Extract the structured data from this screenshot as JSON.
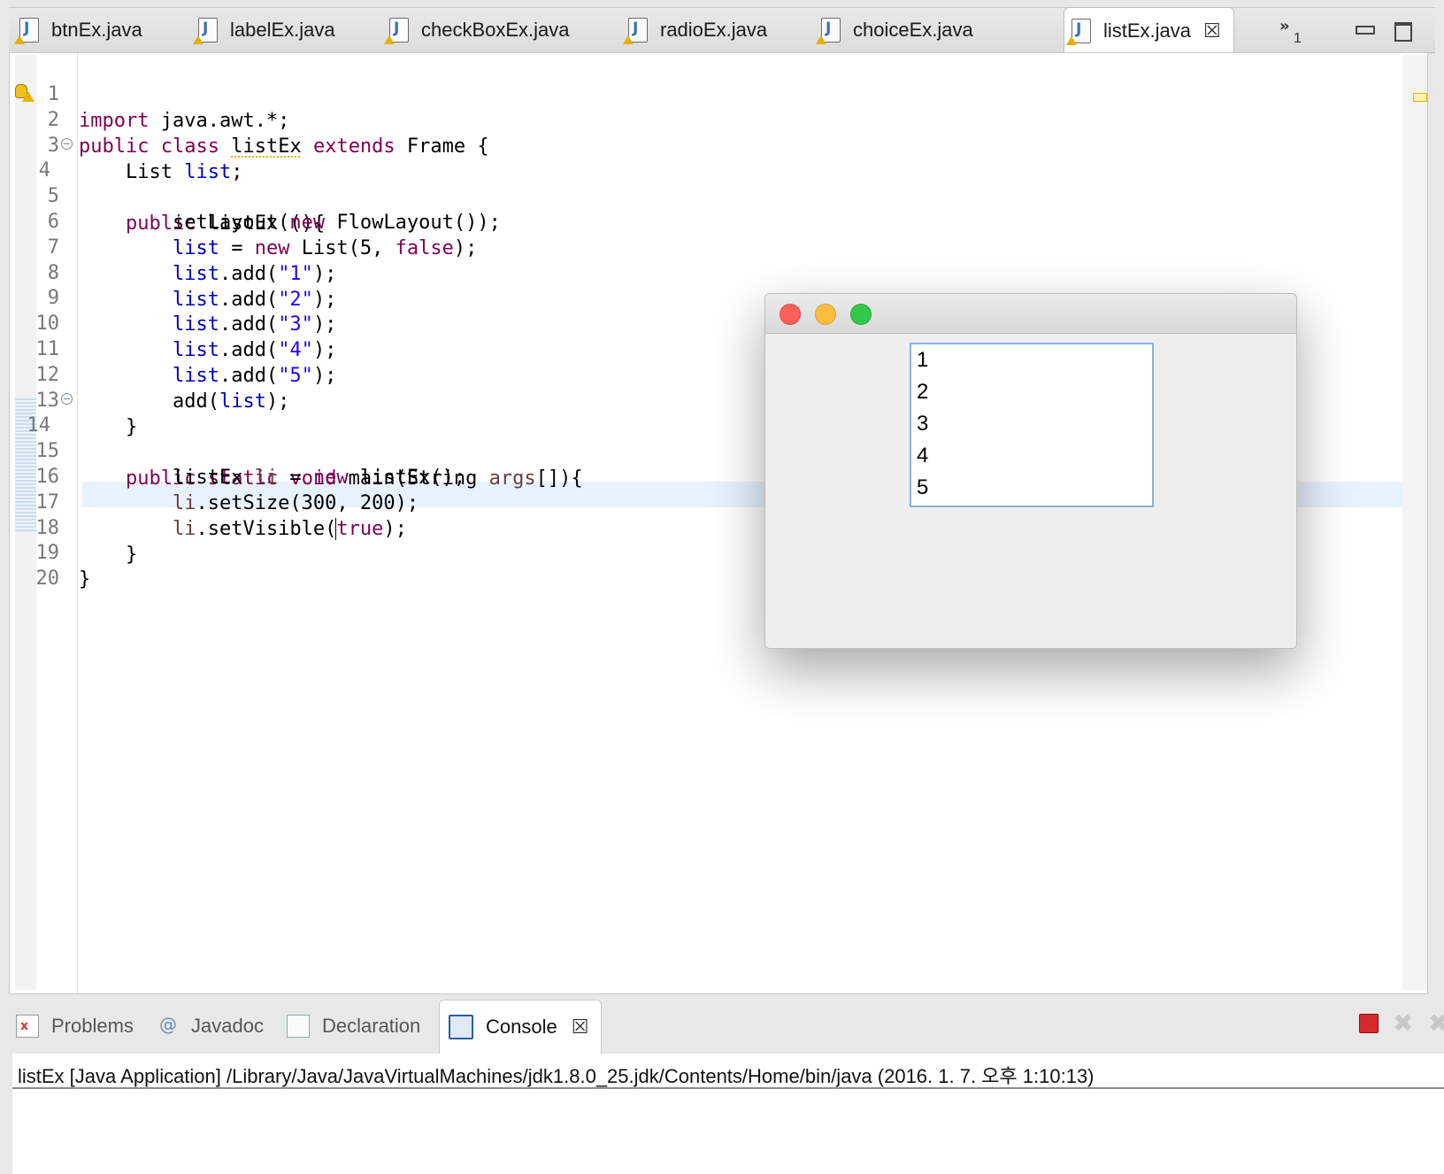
{
  "editor_tabs": [
    {
      "label": "btnEx.java"
    },
    {
      "label": "labelEx.java"
    },
    {
      "label": "checkBoxEx.java"
    },
    {
      "label": "radioEx.java"
    },
    {
      "label": "choiceEx.java"
    },
    {
      "label": "listEx.java",
      "active": true
    }
  ],
  "tab_overflow": {
    "chevron": "»",
    "count": "1"
  },
  "tab_close_glyph": "☒",
  "code": {
    "line_numbers": [
      "1",
      "2",
      "3",
      "4",
      "5",
      "6",
      "7",
      "8",
      "9",
      "10",
      "11",
      "12",
      "13",
      "14",
      "15",
      "16",
      "17",
      "18",
      "19",
      "20"
    ],
    "lines": [
      "import java.awt.*;",
      "public class listEx extends Frame {",
      "    List list;",
      "    public listEx (){",
      "        setLayout(new FlowLayout());",
      "        list = new List(5, false);",
      "        list.add(\"1\");",
      "        list.add(\"2\");",
      "        list.add(\"3\");",
      "        list.add(\"4\");",
      "        list.add(\"5\");",
      "        add(list);",
      "    }",
      "    public static void main(String args[]){",
      "        listEx li = new listEx();",
      "        li.setSize(300, 200);",
      "        li.setVisible(true);",
      "    }",
      "}",
      ""
    ],
    "current_line": 17
  },
  "awt_window": {
    "list_items": [
      "1",
      "2",
      "3",
      "4",
      "5"
    ]
  },
  "panel_tabs": [
    {
      "label": "Problems",
      "icon": "problems-icon"
    },
    {
      "label": "Javadoc",
      "icon": "javadoc-icon"
    },
    {
      "label": "Declaration",
      "icon": "declaration-icon"
    },
    {
      "label": "Console",
      "icon": "console-icon",
      "active": true
    }
  ],
  "console": {
    "header": "listEx [Java Application] /Library/Java/JavaVirtualMachines/jdk1.8.0_25.jdk/Contents/Home/bin/java (2016. 1. 7. 오후 1:10:13)"
  },
  "colors": {
    "keyword": "#7f0055",
    "field": "#0000c0",
    "string": "#2a00ff",
    "current_line": "#e8f2fe",
    "list_border": "#86b3e0"
  }
}
